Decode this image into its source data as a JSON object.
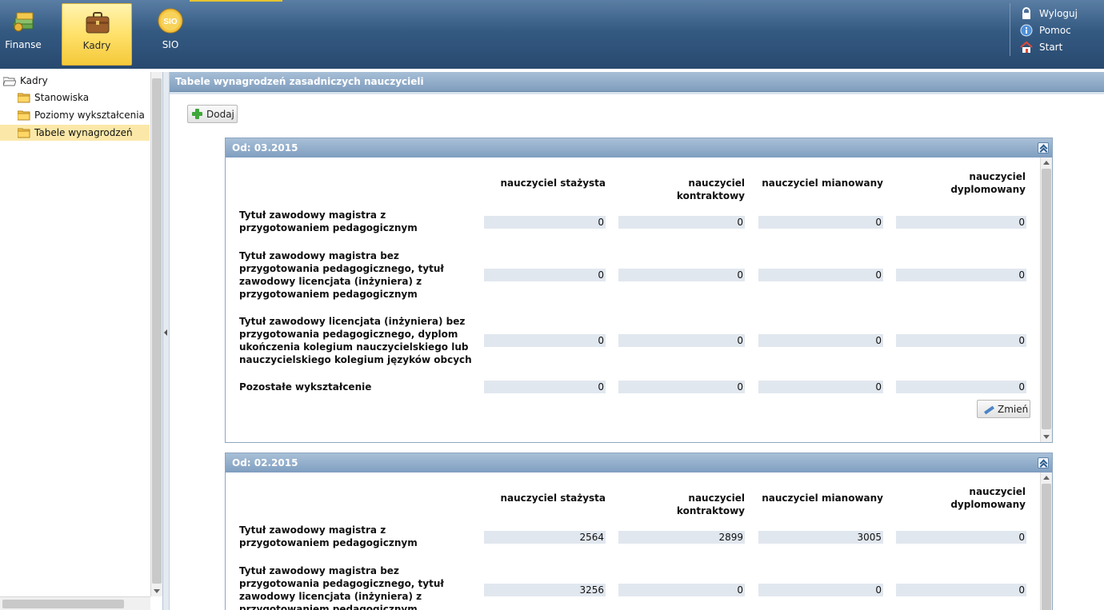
{
  "topbar": {
    "apps": [
      {
        "label": "Finanse",
        "icon": "money-stack-icon"
      },
      {
        "label": "Kadry",
        "icon": "briefcase-icon",
        "active": true
      },
      {
        "label": "SIO",
        "icon": "sio-badge-icon",
        "badge": "SIO"
      }
    ],
    "links": [
      {
        "label": "Wyloguj",
        "icon": "lock-icon"
      },
      {
        "label": "Pomoc",
        "icon": "info-icon"
      },
      {
        "label": "Start",
        "icon": "home-icon"
      }
    ]
  },
  "sidebar": {
    "root": "Kadry",
    "items": [
      {
        "label": "Stanowiska"
      },
      {
        "label": "Poziomy wykształcenia"
      },
      {
        "label": "Tabele wynagrodzeń",
        "selected": true
      }
    ]
  },
  "main": {
    "title": "Tabele wynagrodzeń zasadniczych nauczycieli",
    "add_label": "Dodaj",
    "columns": [
      "nauczyciel stażysta",
      "nauczyciel kontraktowy",
      "nauczyciel mianowany",
      "nauczyciel dyplomowany"
    ],
    "panels": [
      {
        "title": "Od: 03.2015",
        "edit_label": "Zmień",
        "rows": [
          {
            "label": "Tytuł zawodowy magistra z przygotowaniem pedagogicznym",
            "values": [
              "0",
              "0",
              "0",
              "0"
            ]
          },
          {
            "label": "Tytuł zawodowy magistra bez przygotowania pedagogicznego, tytuł zawodowy licencjata (inżyniera) z przygotowaniem pedagogicznym",
            "values": [
              "0",
              "0",
              "0",
              "0"
            ]
          },
          {
            "label": "Tytuł zawodowy licencjata (inżyniera) bez przygotowania pedagogicznego, dyplom ukończenia kolegium nauczycielskiego lub nauczycielskiego kolegium języków obcych",
            "values": [
              "0",
              "0",
              "0",
              "0"
            ]
          },
          {
            "label": "Pozostałe wykształcenie",
            "values": [
              "0",
              "0",
              "0",
              "0"
            ]
          }
        ]
      },
      {
        "title": "Od: 02.2015",
        "rows": [
          {
            "label": "Tytuł zawodowy magistra z przygotowaniem pedagogicznym",
            "values": [
              "2564",
              "2899",
              "3005",
              "0"
            ]
          },
          {
            "label": "Tytuł zawodowy magistra bez przygotowania pedagogicznego, tytuł zawodowy licencjata (inżyniera) z przygotowaniem pedagogicznym",
            "values": [
              "3256",
              "0",
              "0",
              "0"
            ]
          }
        ]
      }
    ]
  },
  "colors": {
    "topbar": "#345a82",
    "active_tab": "#ffe16a",
    "panel_header": "#8fabc9",
    "field_bg": "#e1e7ef",
    "selected_tree": "#fbe8a8"
  }
}
